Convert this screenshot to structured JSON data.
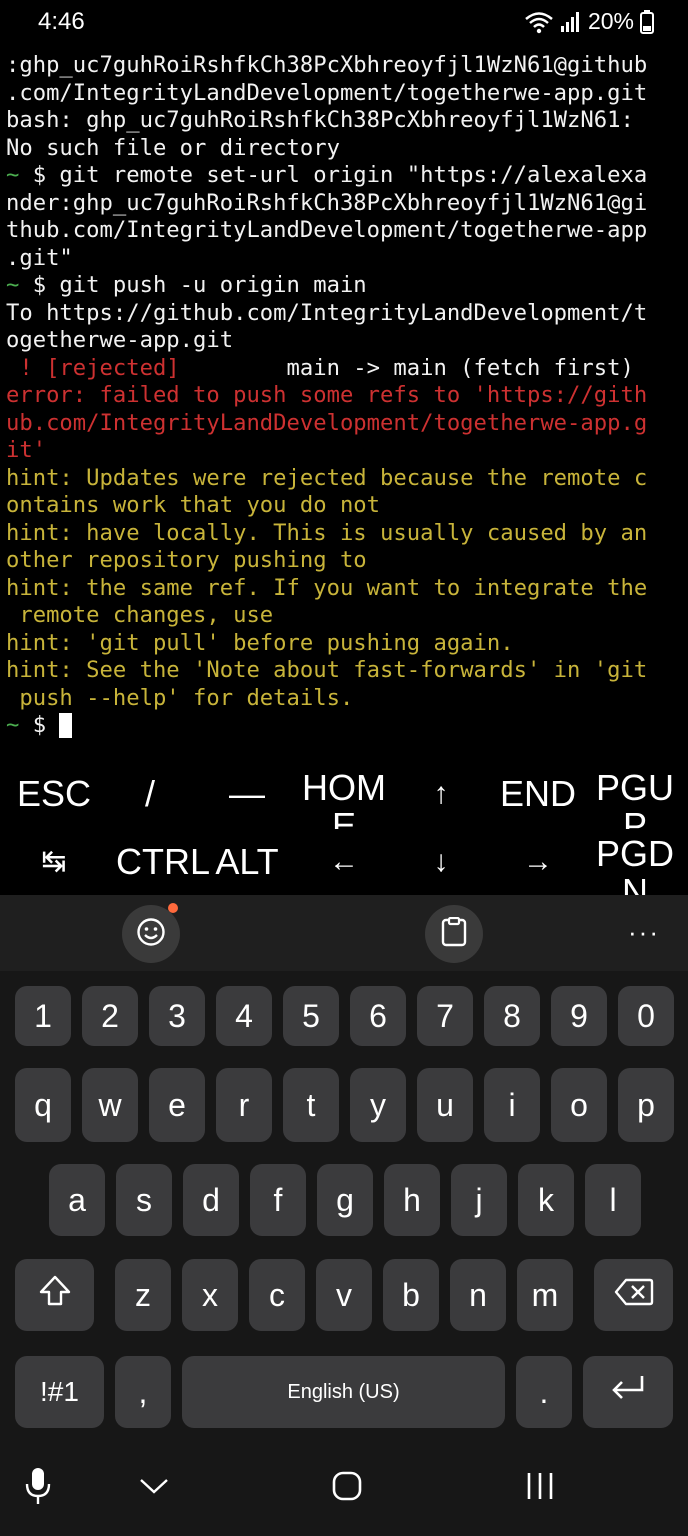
{
  "status_bar": {
    "time": "4:46",
    "battery": "20%"
  },
  "terminal": {
    "lines": [
      [
        {
          "t": ":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@github",
          "c": ""
        }
      ],
      [
        {
          "t": ".com/IntegrityLandDevelopment/togetherwe-app.git",
          "c": ""
        }
      ],
      [
        {
          "t": "bash: 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:",
          "c": ""
        }
      ],
      [
        {
          "t": "No such file or directory",
          "c": ""
        }
      ],
      [
        {
          "t": "~",
          "c": "green"
        },
        {
          "t": " $ git remote set-url origin \"https://alexalexa",
          "c": ""
        }
      ],
      [
        {
          "t": "nder: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@gi",
          "c": ""
        }
      ],
      [
        {
          "t": "thub.com/IntegrityLandDevelopment/togetherwe-app",
          "c": ""
        }
      ],
      [
        {
          "t": ".git\"",
          "c": ""
        }
      ],
      [
        {
          "t": "~",
          "c": "green"
        },
        {
          "t": " $ git push -u origin main",
          "c": ""
        }
      ],
      [
        {
          "t": "To https://github.com/IntegrityLandDevelopment/t",
          "c": ""
        }
      ],
      [
        {
          "t": "ogetherwe-app.git",
          "c": ""
        }
      ],
      [
        {
          "t": " ! [rejected]",
          "c": "red"
        },
        {
          "t": "        main -> main (fetch first)",
          "c": ""
        }
      ],
      [
        {
          "t": "error: failed to push some refs to 'https://gith",
          "c": "red"
        }
      ],
      [
        {
          "t": "ub.com/IntegrityLandDevelopment/togetherwe-app.g",
          "c": "red"
        }
      ],
      [
        {
          "t": "it'",
          "c": "red"
        }
      ],
      [
        {
          "t": "hint: Updates were rejected because the remote c",
          "c": "yellow"
        }
      ],
      [
        {
          "t": "ontains work that you do not",
          "c": "yellow"
        }
      ],
      [
        {
          "t": "hint: have locally. This is usually caused by an",
          "c": "yellow"
        }
      ],
      [
        {
          "t": "other repository pushing to",
          "c": "yellow"
        }
      ],
      [
        {
          "t": "hint: the same ref. If you want to integrate the",
          "c": "yellow"
        }
      ],
      [
        {
          "t": " remote changes, use",
          "c": "yellow"
        }
      ],
      [
        {
          "t": "hint: 'git pull' before pushing again.",
          "c": "yellow"
        }
      ],
      [
        {
          "t": "hint: See the 'Note about fast-forwards' in 'git",
          "c": "yellow"
        }
      ],
      [
        {
          "t": " push --help' for details.",
          "c": "yellow"
        }
      ]
    ],
    "prompt_tilde": "~",
    "prompt_symbol": " $ "
  },
  "extra_keys": {
    "row1": [
      "ESC",
      "/",
      "—",
      "HOME",
      "↑",
      "END",
      "PGUP"
    ],
    "row2": [
      "↹",
      "CTRL",
      "ALT",
      "←",
      "↓",
      "→",
      "PGDN"
    ]
  },
  "keyboard": {
    "numbers": [
      "1",
      "2",
      "3",
      "4",
      "5",
      "6",
      "7",
      "8",
      "9",
      "0"
    ],
    "row_q": [
      "q",
      "w",
      "e",
      "r",
      "t",
      "y",
      "u",
      "i",
      "o",
      "p"
    ],
    "row_a": [
      "a",
      "s",
      "d",
      "f",
      "g",
      "h",
      "j",
      "k",
      "l"
    ],
    "row_z": [
      "z",
      "x",
      "c",
      "v",
      "b",
      "n",
      "m"
    ],
    "symbols_key": "!#1",
    "comma_key": ",",
    "space_label": "English (US)",
    "period_key": "."
  },
  "colors": {
    "prompt": "#4caf50",
    "error": "#cd3131",
    "hint": "#c8b43a",
    "key_bg": "#3b3b3d",
    "notification_dot": "#ff6a3d"
  }
}
